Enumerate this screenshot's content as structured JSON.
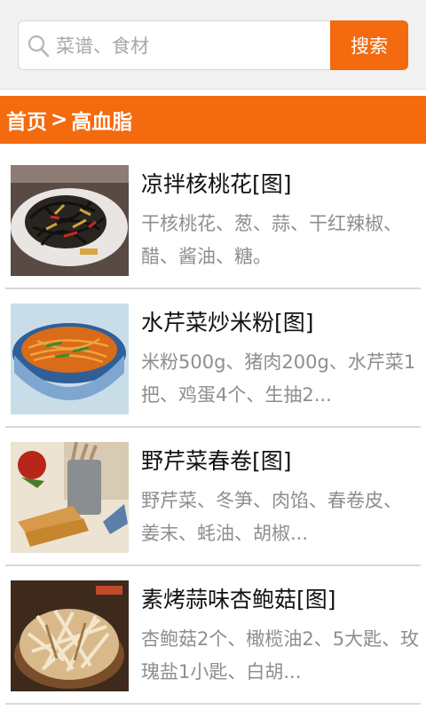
{
  "search": {
    "placeholder": "菜谱、食材",
    "button_label": "搜索"
  },
  "breadcrumb": {
    "home": "首页",
    "separator": ">",
    "current": "高血脂"
  },
  "colors": {
    "accent": "#f46a0e",
    "divider": "#d9d9d9",
    "desc_text": "#8e8e8e"
  },
  "recipes": [
    {
      "title": "凉拌核桃花[图]",
      "line1": "干核桃花、葱、蒜、干红辣椒、",
      "line2": "醋、酱油、糖。"
    },
    {
      "title": "水芹菜炒米粉[图]",
      "line1": "米粉500g、猪肉200g、水芹菜1",
      "line2": "把、鸡蛋4个、生抽2..."
    },
    {
      "title": "野芹菜春卷[图]",
      "line1": "野芹菜、冬笋、肉馅、春卷皮、",
      "line2": "姜末、蚝油、胡椒..."
    },
    {
      "title": "素烤蒜味杏鲍菇[图]",
      "line1": "杏鲍菇2个、橄榄油2、5大匙、玫",
      "line2": "瑰盐1小匙、白胡..."
    }
  ]
}
